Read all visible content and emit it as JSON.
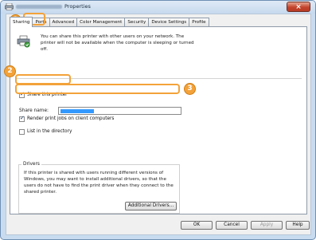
{
  "window": {
    "title": "Properties",
    "close_label": "×"
  },
  "tabs": [
    {
      "label": "Sharing"
    },
    {
      "label": "Ports"
    },
    {
      "label": "Advanced"
    },
    {
      "label": "Color Management"
    },
    {
      "label": "Security"
    },
    {
      "label": "Device Settings"
    },
    {
      "label": "Profile"
    }
  ],
  "sharing": {
    "description": "You can share this printer with other users on your network. The printer will not be available when the computer is sleeping or turned off.",
    "share_checkbox": {
      "label": "Share this printer",
      "checked": true
    },
    "share_name": {
      "label": "Share name:",
      "value": ""
    },
    "render_checkbox": {
      "label": "Render print jobs on client computers",
      "checked": true
    },
    "directory_checkbox": {
      "label": "List in the directory",
      "checked": false
    }
  },
  "drivers": {
    "title": "Drivers",
    "text": "If this printer is shared with users running different versions of Windows, you may want to install additional drivers, so that the users do not have to find the print driver when they connect to the shared printer.",
    "button": "Additional Drivers..."
  },
  "footer": {
    "ok": "OK",
    "cancel": "Cancel",
    "apply": "Apply",
    "help": "Help"
  },
  "callouts": [
    "1",
    "2",
    "3"
  ],
  "colors": {
    "callout": "#f3a23a",
    "selection": "#3399ff",
    "titlebar": "#c9dcef"
  }
}
